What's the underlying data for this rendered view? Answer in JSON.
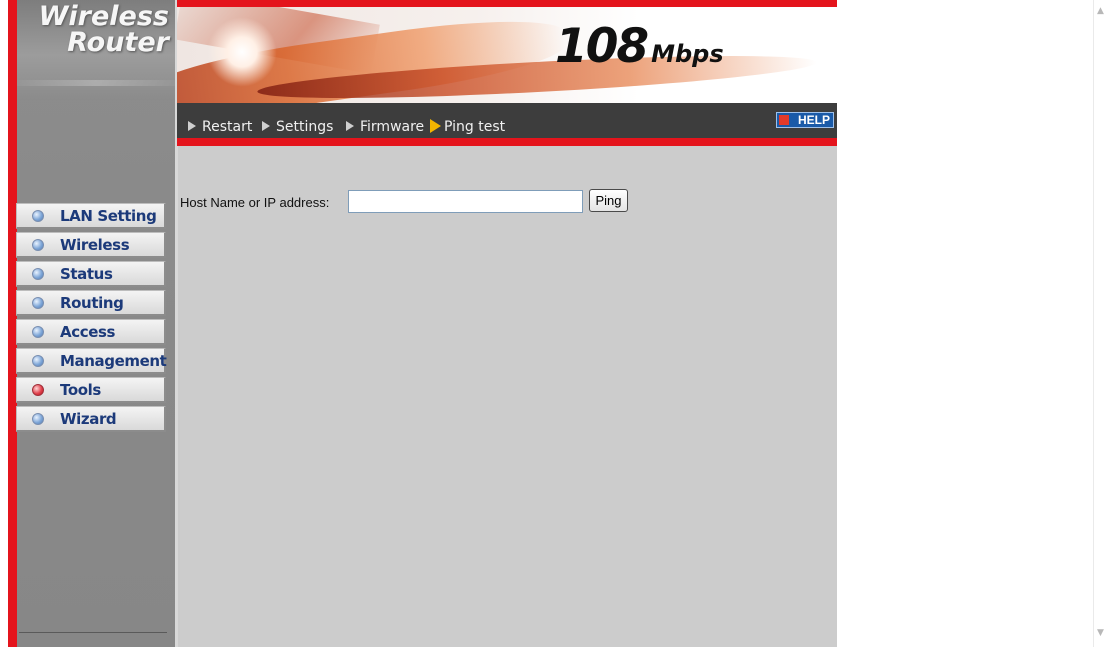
{
  "sidebar": {
    "logo_line1": "Wireless",
    "logo_line2": "Router",
    "items": [
      {
        "label": "LAN Setting",
        "active": false
      },
      {
        "label": "Wireless",
        "active": false
      },
      {
        "label": "Status",
        "active": false
      },
      {
        "label": "Routing",
        "active": false
      },
      {
        "label": "Access",
        "active": false
      },
      {
        "label": "Management",
        "active": false
      },
      {
        "label": "Tools",
        "active": true
      },
      {
        "label": "Wizard",
        "active": false
      }
    ]
  },
  "banner": {
    "speed_number": "108",
    "speed_unit": "Mbps"
  },
  "nav": {
    "items": [
      {
        "label": "Restart",
        "active": false
      },
      {
        "label": "Settings",
        "active": false
      },
      {
        "label": "Firmware",
        "active": false
      },
      {
        "label": "Ping test",
        "active": true
      }
    ],
    "help_label": "HELP"
  },
  "form": {
    "host_label": "Host Name or IP address:",
    "host_value": "",
    "ping_button": "Ping"
  },
  "colors": {
    "brand_red": "#e4141c",
    "nav_bg": "#3d3d3d",
    "content_bg": "#cccccc",
    "menu_text": "#1c3a7a",
    "active_indicator": "#e1424d"
  },
  "icons": {
    "menu_bullet": "blue-orb-icon",
    "menu_bullet_active": "red-orb-icon",
    "nav_arrow": "triangle-right-icon",
    "help": "help-icon"
  }
}
